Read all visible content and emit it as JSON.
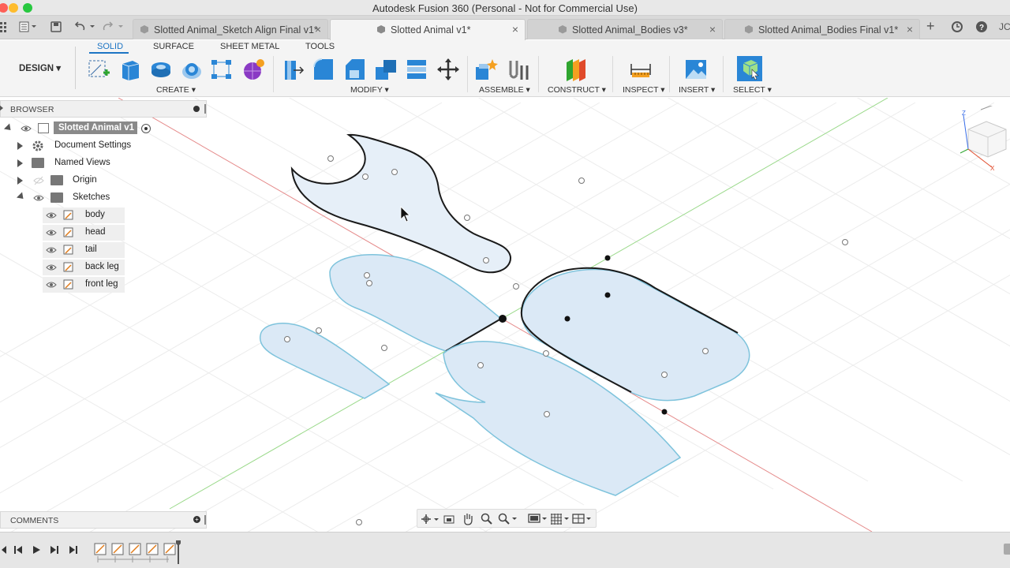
{
  "window": {
    "title": "Autodesk Fusion 360 (Personal - Not for Commercial Use)"
  },
  "tabs": [
    {
      "label": "Slotted Animal_Sketch Align Final v1*",
      "active": false
    },
    {
      "label": "Slotted Animal v1*",
      "active": true
    },
    {
      "label": "Slotted Animal_Bodies v3*",
      "active": false
    },
    {
      "label": "Slotted Animal_Bodies Final v1*",
      "active": false
    }
  ],
  "user_initials": "JC",
  "toolbar": {
    "workspace": "DESIGN ▾",
    "tabs": [
      "SOLID",
      "SURFACE",
      "SHEET METAL",
      "TOOLS"
    ],
    "active_tab": "SOLID",
    "groups": {
      "create": "CREATE ▾",
      "modify": "MODIFY ▾",
      "assemble": "ASSEMBLE ▾",
      "construct": "CONSTRUCT ▾",
      "inspect": "INSPECT ▾",
      "insert": "INSERT ▾",
      "select": "SELECT ▾"
    }
  },
  "browser": {
    "header": "BROWSER",
    "root": "Slotted Animal v1",
    "items": {
      "document_settings": "Document Settings",
      "named_views": "Named Views",
      "origin": "Origin",
      "sketches": "Sketches"
    },
    "sketches": [
      "body",
      "head",
      "tail",
      "back leg",
      "front leg"
    ]
  },
  "comments": {
    "header": "COMMENTS"
  },
  "colors": {
    "accent": "#1c74c4",
    "sketch_fill": "#dbe9f6",
    "sketch_profile": "#7ec3dc",
    "x_axis": "#e58a8a",
    "y_axis": "#9ad98a"
  },
  "icons": {
    "viewcube": "view-cube-icon",
    "cursor": "arrow-cursor-icon"
  }
}
